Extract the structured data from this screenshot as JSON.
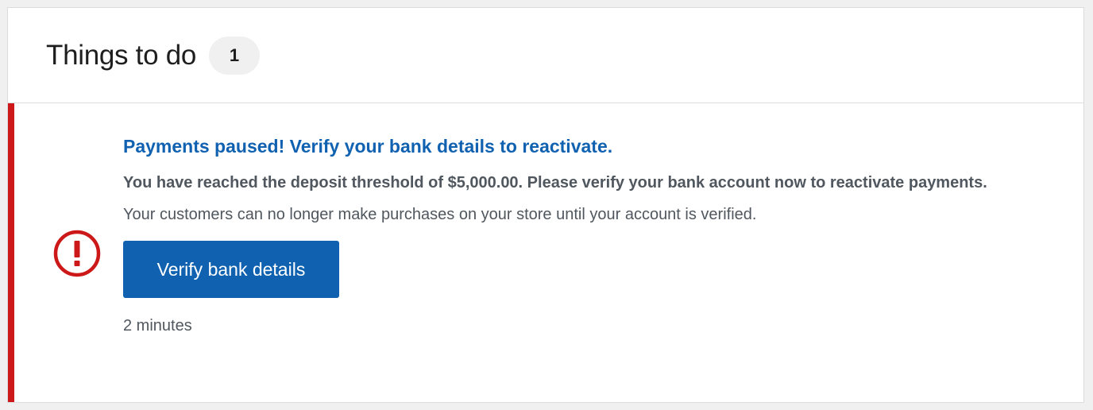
{
  "header": {
    "title": "Things to do",
    "count": "1"
  },
  "task": {
    "icon": "alert-circle-icon",
    "title": "Payments paused! Verify your bank details to reactivate.",
    "description_bold": "You have reached the deposit threshold of $5,000.00. Please verify your bank account now to reactivate payments.",
    "description_rest": " Your customers can no longer make purchases on your store until your account is verified.",
    "button_label": "Verify bank details",
    "time": "2 minutes"
  },
  "colors": {
    "accent": "#1062b1",
    "alert": "#cc1818"
  }
}
